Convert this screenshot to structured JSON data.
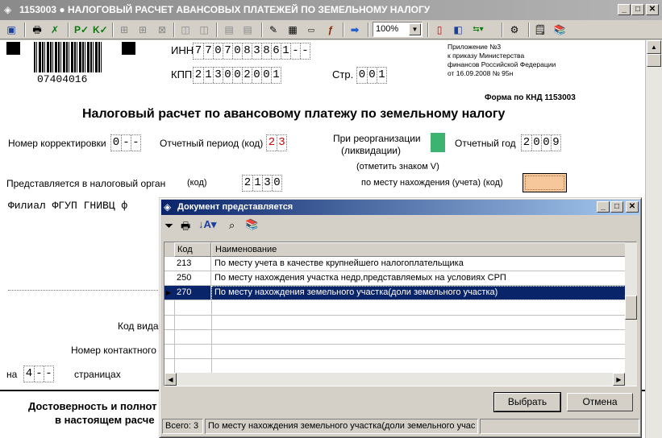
{
  "window": {
    "title": "1153003 ● НАЛОГОВЫЙ РАСЧЕТ АВАНСОВЫХ ПЛАТЕЖЕЙ ПО ЗЕМЕЛЬНОМУ НАЛОГУ",
    "min": "_",
    "max": "□",
    "close": "✕"
  },
  "toolbar": {
    "zoom": "100%"
  },
  "form": {
    "barcode_number": "07404016",
    "inn_label": "ИНН",
    "inn": [
      "7",
      "7",
      "0",
      "7",
      "0",
      "8",
      "3",
      "8",
      "6",
      "1",
      "-",
      "-"
    ],
    "kpp_label": "КПП",
    "kpp": [
      "2",
      "1",
      "3",
      "0",
      "0",
      "2",
      "0",
      "0",
      "1"
    ],
    "page_label": "Стр.",
    "page": [
      "0",
      "0",
      "1"
    ],
    "appendix": [
      "Приложение №3",
      "к приказу Министерства",
      "финансов Российской Федерации",
      "от 16.09.2008 № 95н"
    ],
    "knd": "Форма по КНД 1153003",
    "title": "Налоговый расчет по авансовому платежу по земельному налогу",
    "correction_label": "Номер корректировки",
    "correction": [
      "0",
      "-",
      "-"
    ],
    "period_label": "Отчетный период (код)",
    "period": [
      "2",
      "3"
    ],
    "reorg_label_1": "При реорганизации",
    "reorg_label_2": "(ликвидации)",
    "year_label": "Отчетный год",
    "year": [
      "2",
      "0",
      "0",
      "9"
    ],
    "mark_hint": "(отметить знаком V)",
    "tax_organ_label": "Представляется в налоговый орган",
    "code_label": "(код)",
    "tax_organ": [
      "2",
      "1",
      "3",
      "0"
    ],
    "location_label": "по месту нахождения (учета) (код)",
    "org_name": "Филиал ФГУП ГНИВЦ ф",
    "view_code_label": "Код вида",
    "phone_label": "Номер контактного",
    "on_label": "на",
    "pages": [
      "4",
      "-",
      "-"
    ],
    "pages_label": "страницах",
    "reliability_1": "Достоверность и полнот",
    "reliability_2": "в настоящем расче"
  },
  "dialog": {
    "title": "Документ представляется",
    "columns": [
      "Код",
      "Наименование"
    ],
    "rows": [
      {
        "code": "213",
        "name": "По месту учета в качестве крупнейшего налогоплательщика"
      },
      {
        "code": "250",
        "name": "По месту нахождения участка недр,представляемых на условиях СРП"
      },
      {
        "code": "270",
        "name": "По месту нахождения земельного участка(доли земельного участка)"
      }
    ],
    "select_button": "Выбрать",
    "cancel_button": "Отмена",
    "status_total": "Всего: 3",
    "status_current": "По месту нахождения земельного участка(доли земельного учас"
  },
  "colors": {
    "selection": "#0a246a",
    "title_active": "#0a246a",
    "title_inactive": "#8a8a8a",
    "reorg_box": "#3cb371",
    "location_box": "#f5c79a"
  }
}
